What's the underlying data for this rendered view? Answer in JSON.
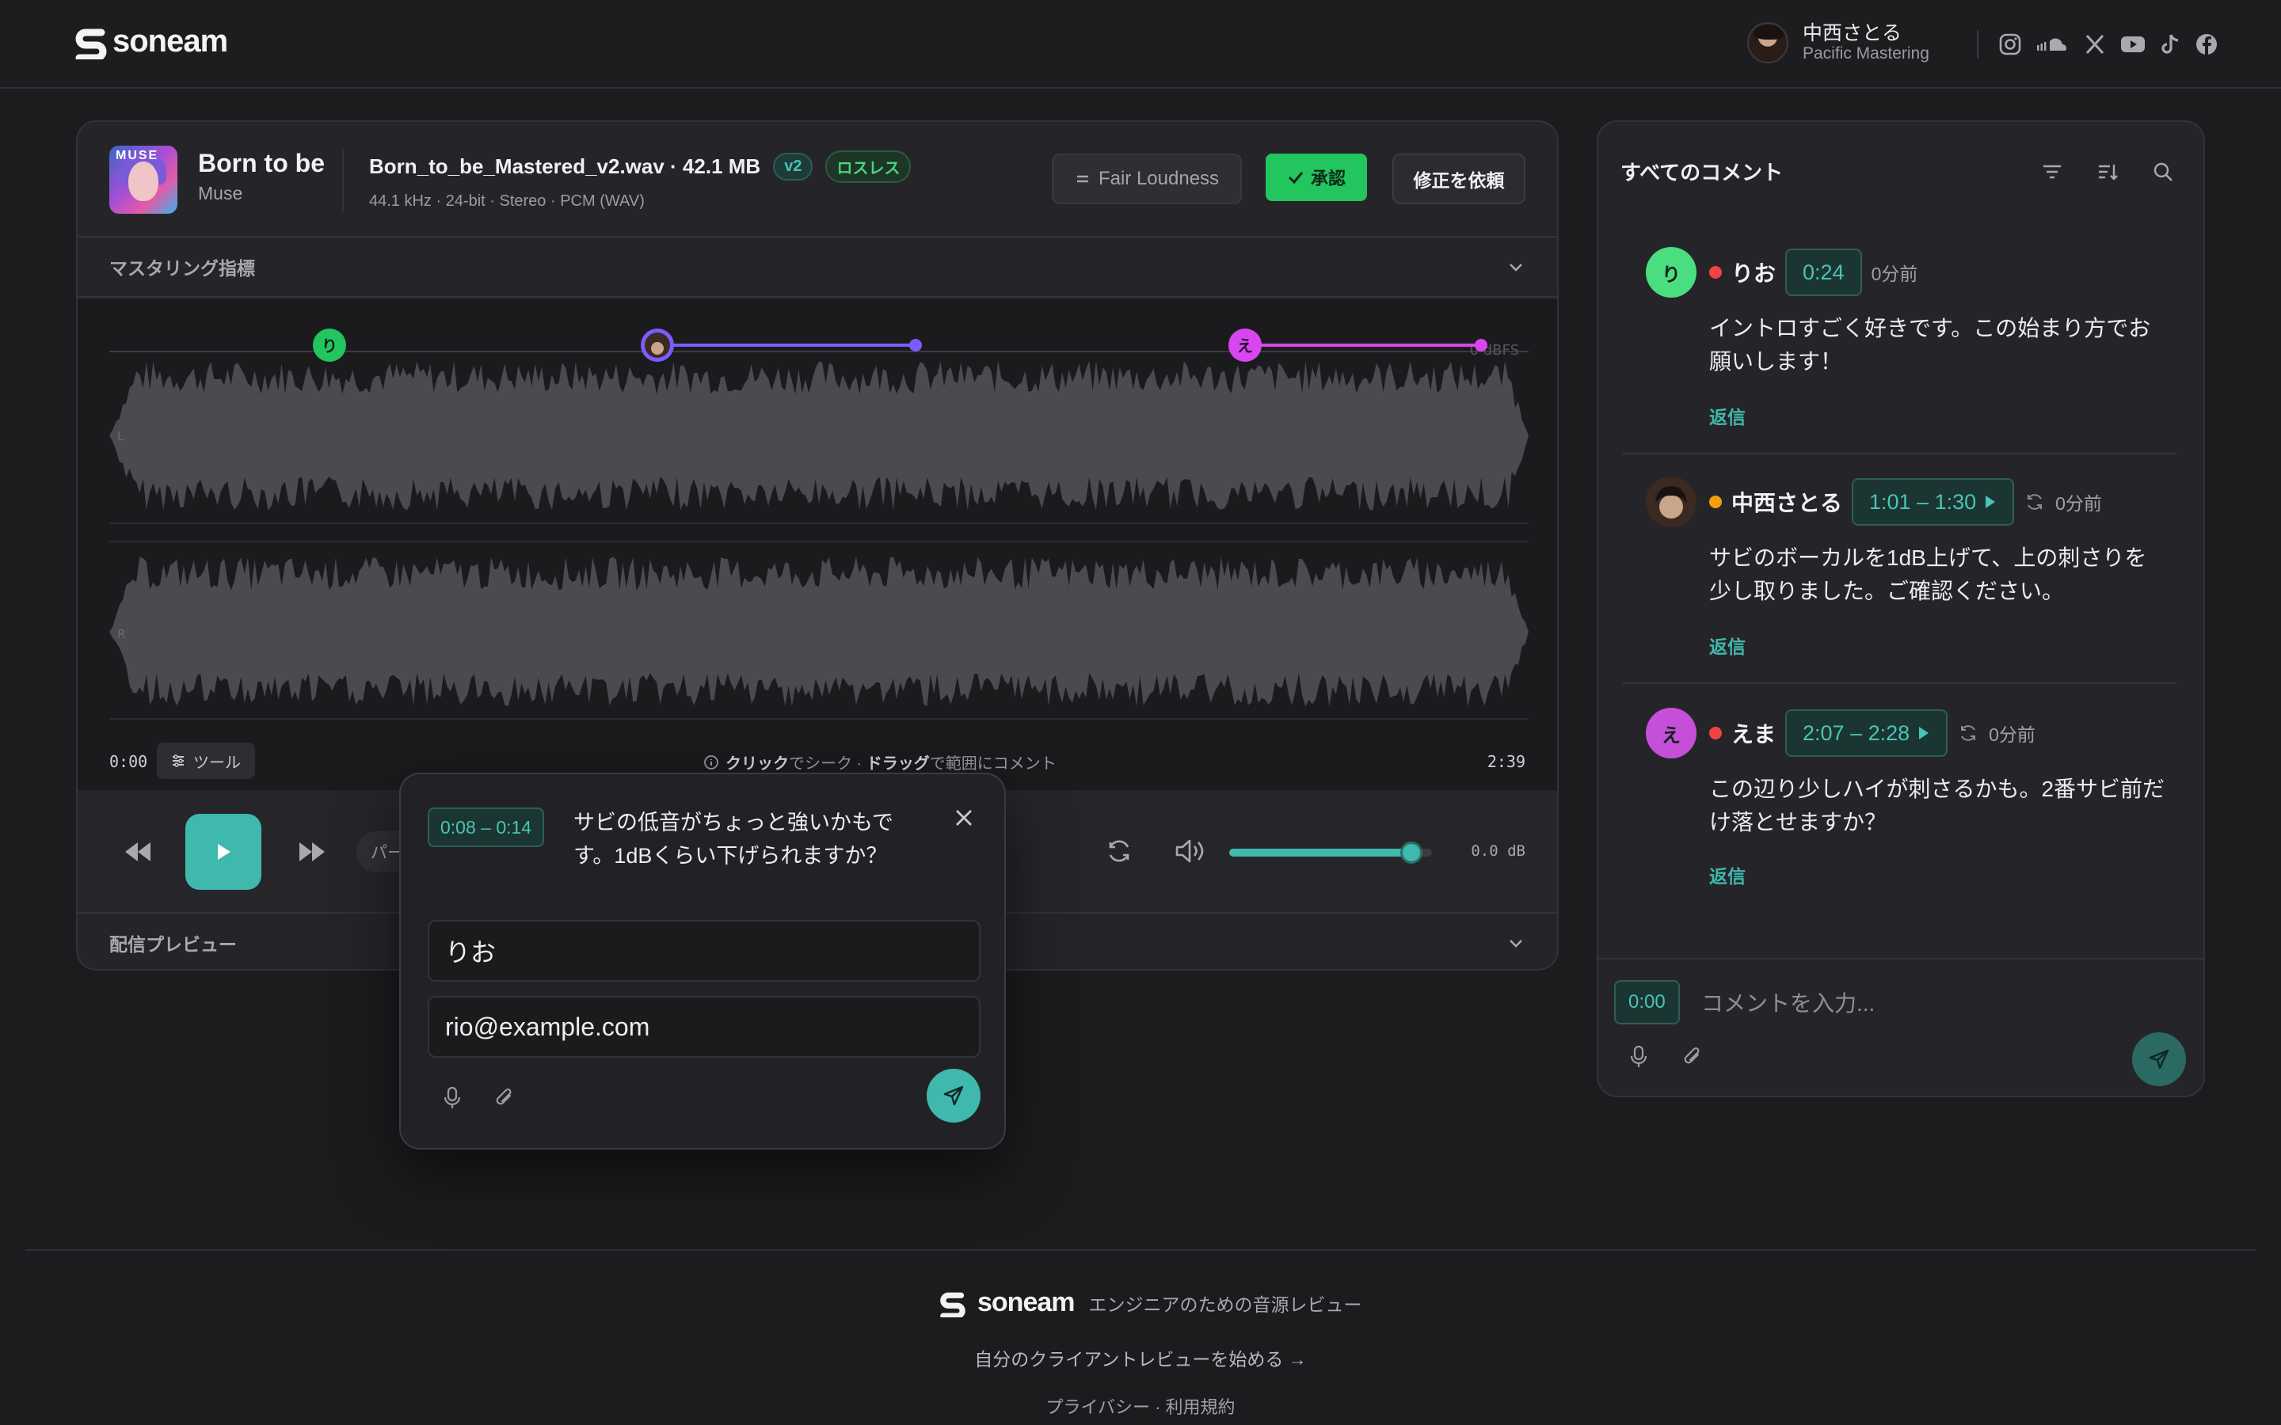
{
  "brand": {
    "name": "soneam",
    "tagline": "エンジニアのための音源レビュー"
  },
  "user": {
    "name": "中西さとる",
    "org": "Pacific Mastering"
  },
  "socials": [
    "instagram-icon",
    "soundcloud-icon",
    "x-icon",
    "youtube-icon",
    "tiktok-icon",
    "facebook-icon"
  ],
  "track": {
    "title": "Born to be",
    "artist": "Muse",
    "file_name": "Born_to_be_Mastered_v2.wav · 42.1 MB",
    "version_badge": "v2",
    "lossless_badge": "ロスレス",
    "meta": "44.1 kHz · 24-bit · Stereo · PCM (WAV)",
    "loudness_button": "Fair Loudness",
    "approve_button": "承認",
    "revise_button": "修正を依頼"
  },
  "sections": {
    "metrics": "マスタリング指標",
    "preview": "配信プレビュー"
  },
  "waveform": {
    "dbfs_label": "0 dBFS",
    "channel_left": "L",
    "channel_right": "R",
    "time_start": "0:00",
    "time_end": "2:39",
    "tools_label": "ツール",
    "hint_click": "クリック",
    "hint_seek": "でシーク · ",
    "hint_drag": "ドラッグ",
    "hint_range": "で範囲にコメント",
    "markers": [
      {
        "initial": "り",
        "color": "#22c55e"
      },
      {
        "initial": "",
        "color": "#7c5cff"
      },
      {
        "initial": "え",
        "color": "#d946ef"
      }
    ]
  },
  "transport": {
    "part_chip": "パー",
    "volume": 0.9,
    "db_readout": "0.0 dB"
  },
  "popover": {
    "range": "0:08 – 0:14",
    "text": "サビの低音がちょっと強いかもです。1dBくらい下げられますか？",
    "name_value": "りお",
    "email_value": "rio@example.com"
  },
  "comments": {
    "title": "すべてのコメント",
    "items": [
      {
        "initial": "り",
        "avatar_color": "#4ade80",
        "status_color": "#ef4444",
        "name": "りお",
        "time": "0:24",
        "ago": "0分前",
        "body": "イントロすごく好きです。この始まり方でお願いします！",
        "reply": "返信",
        "has_play": false
      },
      {
        "initial": "",
        "avatar_color": "#3a2a22",
        "status_color": "#f59e0b",
        "name": "中西さとる",
        "time": "1:01 – 1:30",
        "ago": "0分前",
        "body": "サビのボーカルを1dB上げて、上の刺さりを少し取りました。ご確認ください。",
        "reply": "返信",
        "has_play": true
      },
      {
        "initial": "え",
        "avatar_color": "#c54fd9",
        "status_color": "#ef4444",
        "name": "えま",
        "time": "2:07 – 2:28",
        "ago": "0分前",
        "body": "この辺り少しハイが刺さるかも。2番サビ前だけ落とせますか？",
        "reply": "返信",
        "has_play": true
      }
    ],
    "composer_time": "0:00",
    "composer_placeholder": "コメントを入力..."
  },
  "footer": {
    "cta": "自分のクライアントレビューを始める →",
    "legal": "プライバシー · 利用規約"
  }
}
